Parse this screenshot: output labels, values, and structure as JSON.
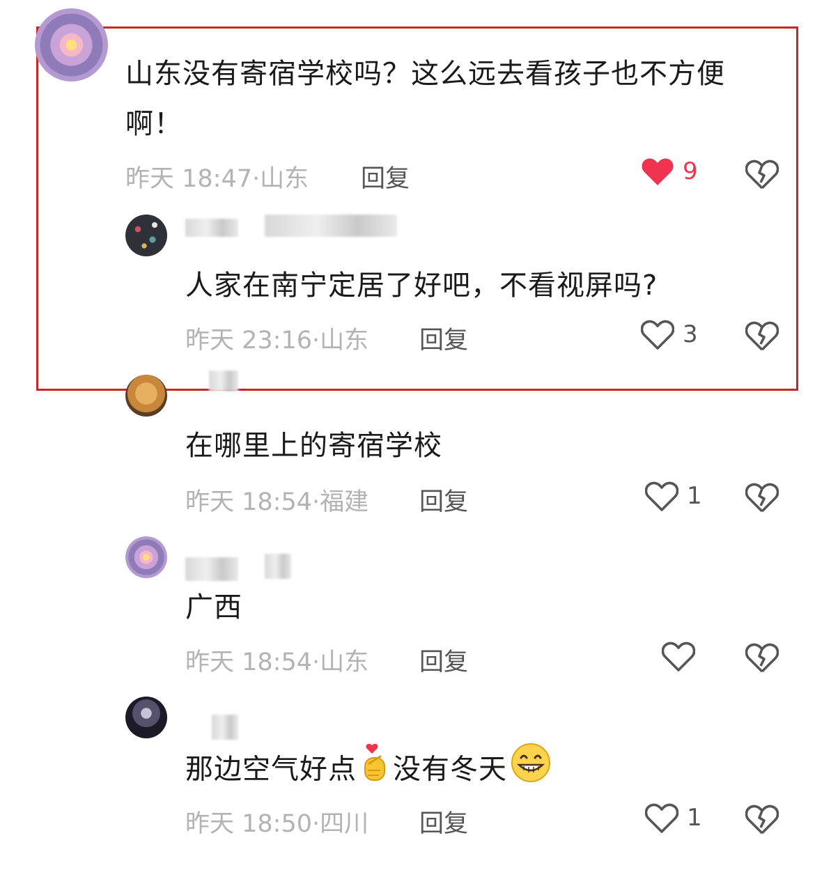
{
  "comments": [
    {
      "text": "山东没有寄宿学校吗？这么远去看孩子也不方便啊！",
      "time": "昨天 18:47",
      "location": "山东",
      "reply_label": "回复",
      "likes": "9"
    },
    {
      "text": "人家在南宁定居了好吧，不看视屏吗?",
      "time": "昨天 23:16",
      "location": "山东",
      "reply_label": "回复",
      "likes": "3"
    },
    {
      "text": "在哪里上的寄宿学校",
      "time": "昨天 18:54",
      "location": "福建",
      "reply_label": "回复",
      "likes": "1"
    },
    {
      "text": "广西",
      "time": "昨天 18:54",
      "location": "山东",
      "reply_label": "回复",
      "likes": ""
    },
    {
      "text_parts": [
        "那边空气好点",
        "没有冬天"
      ],
      "time": "昨天 18:50",
      "location": "四川",
      "reply_label": "回复",
      "likes": "1"
    }
  ],
  "separator": "·",
  "colors": {
    "highlight_border": "#c62828",
    "liked_heart": "#f0334f",
    "meta_gray": "#b3b3b3"
  },
  "icons": {
    "like": "heart-icon",
    "liked": "filled-heart-icon",
    "dislike": "broken-heart-icon",
    "emoji1": "finger-heart-emoji",
    "emoji2": "grinning-face-emoji"
  }
}
